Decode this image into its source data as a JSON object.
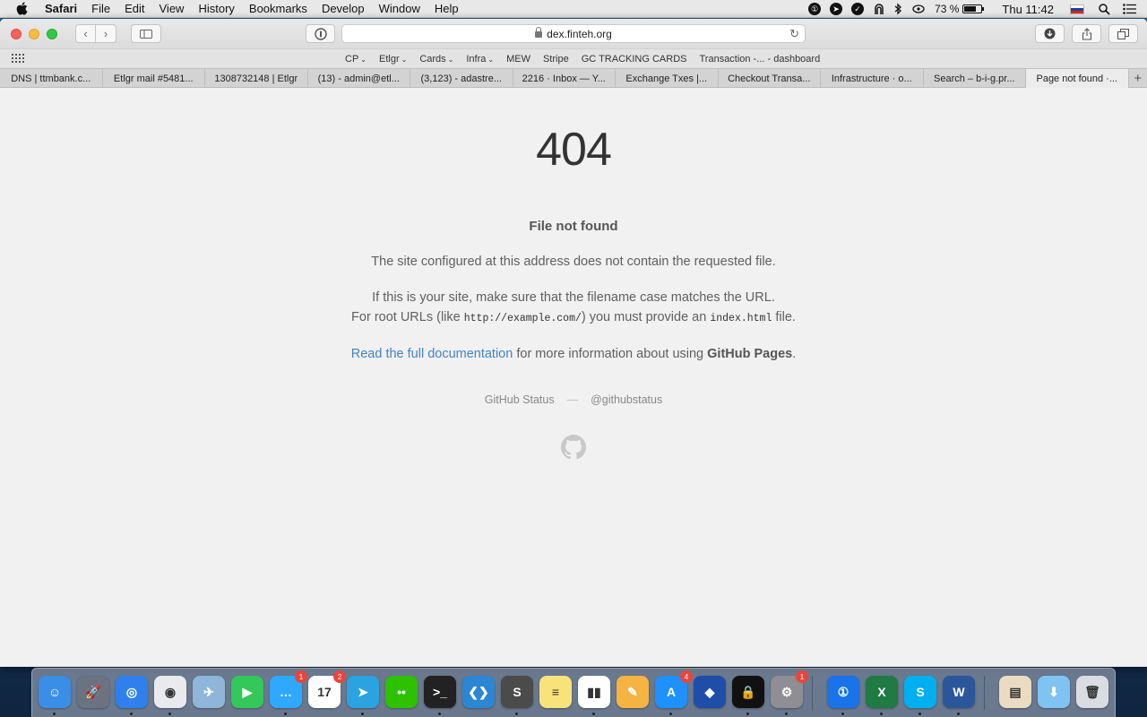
{
  "menubar": {
    "app_name": "Safari",
    "menus": [
      "File",
      "Edit",
      "View",
      "History",
      "Bookmarks",
      "Develop",
      "Window",
      "Help"
    ],
    "battery": "73 %",
    "battery_level": 0.73,
    "clock": "Thu 11:42"
  },
  "browser": {
    "url": "dex.finteh.org",
    "favorites": [
      {
        "label": "CP",
        "has_menu": true
      },
      {
        "label": "Etlgr",
        "has_menu": true
      },
      {
        "label": "Cards",
        "has_menu": true
      },
      {
        "label": "Infra",
        "has_menu": true
      },
      {
        "label": "MEW",
        "has_menu": false
      },
      {
        "label": "Stripe",
        "has_menu": false
      },
      {
        "label": "GC TRACKING CARDS",
        "has_menu": false
      },
      {
        "label": "Transaction -... - dashboard",
        "has_menu": false
      }
    ],
    "tabs": [
      {
        "label": "DNS | ttmbank.c...",
        "active": false
      },
      {
        "label": "Etlgr mail #5481...",
        "active": false
      },
      {
        "label": "1308732148 | Etlgr",
        "active": false
      },
      {
        "label": "(13) - admin@etl...",
        "active": false
      },
      {
        "label": "(3,123) - adastre...",
        "active": false
      },
      {
        "label": "2216 · Inbox — Y...",
        "active": false
      },
      {
        "label": "Exchange Txes |...",
        "active": false
      },
      {
        "label": "Checkout Transa...",
        "active": false
      },
      {
        "label": "Infrastructure · o...",
        "active": false
      },
      {
        "label": "Search – b-i-g.pr...",
        "active": false
      },
      {
        "label": "Page not found ·...",
        "active": true
      }
    ]
  },
  "page": {
    "code": "404",
    "title": "File not found",
    "para1": "The site configured at this address does not contain the requested file.",
    "para2_line1": "If this is your site, make sure that the filename case matches the URL.",
    "para2_line2_a": "For root URLs (like ",
    "para2_code1": "http://example.com/",
    "para2_line2_b": ") you must provide an ",
    "para2_code2": "index.html",
    "para2_line2_c": " file.",
    "docs_link": "Read the full documentation",
    "para3_mid": " for more information about using ",
    "para3_bold": "GitHub Pages",
    "para3_end": ".",
    "footer_status": "GitHub Status",
    "footer_sep": "—",
    "footer_handle": "@githubstatus"
  },
  "dock": {
    "apps": [
      {
        "name": "finder-icon",
        "color": "#3a8ee6",
        "glyph": "☺",
        "running": true,
        "badge": ""
      },
      {
        "name": "launchpad-icon",
        "color": "#6b7280",
        "glyph": "🚀",
        "running": false,
        "badge": ""
      },
      {
        "name": "safari-icon",
        "color": "#2f80ed",
        "glyph": "◎",
        "running": true,
        "badge": ""
      },
      {
        "name": "chrome-icon",
        "color": "#e8eaed",
        "glyph": "◉",
        "running": true,
        "badge": ""
      },
      {
        "name": "preview-icon",
        "color": "#8fb6d8",
        "glyph": "✈",
        "running": false,
        "badge": ""
      },
      {
        "name": "facetime-icon",
        "color": "#34c759",
        "glyph": "▶",
        "running": false,
        "badge": ""
      },
      {
        "name": "messages-icon",
        "color": "#2fa8ff",
        "glyph": "…",
        "running": true,
        "badge": "1"
      },
      {
        "name": "calendar-icon",
        "color": "#ffffff",
        "glyph": "17",
        "running": false,
        "badge": "2"
      },
      {
        "name": "telegram-icon",
        "color": "#2aa3e0",
        "glyph": "➤",
        "running": true,
        "badge": ""
      },
      {
        "name": "wechat-icon",
        "color": "#2dc100",
        "glyph": "••",
        "running": false,
        "badge": ""
      },
      {
        "name": "terminal-icon",
        "color": "#222222",
        "glyph": ">_",
        "running": true,
        "badge": ""
      },
      {
        "name": "vscode-icon",
        "color": "#2b86d4",
        "glyph": "❮❯",
        "running": false,
        "badge": ""
      },
      {
        "name": "sublime-text-icon",
        "color": "#4b4b4b",
        "glyph": "S",
        "running": true,
        "badge": ""
      },
      {
        "name": "notes-icon",
        "color": "#f7e37a",
        "glyph": "≡",
        "running": false,
        "badge": ""
      },
      {
        "name": "numbers-icon",
        "color": "#ffffff",
        "glyph": "▮▮",
        "running": true,
        "badge": ""
      },
      {
        "name": "pages-icon",
        "color": "#f5b342",
        "glyph": "✎",
        "running": false,
        "badge": ""
      },
      {
        "name": "app-store-icon",
        "color": "#1e90ff",
        "glyph": "A",
        "running": true,
        "badge": "4"
      },
      {
        "name": "trezor-icon",
        "color": "#1f4ea8",
        "glyph": "◆",
        "running": false,
        "badge": ""
      },
      {
        "name": "lock-app-icon",
        "color": "#111111",
        "glyph": "🔒",
        "running": true,
        "badge": ""
      },
      {
        "name": "system-preferences-icon",
        "color": "#8e8e93",
        "glyph": "⚙",
        "running": true,
        "badge": "1"
      },
      {
        "name": "1password-icon",
        "color": "#1a73e8",
        "glyph": "①",
        "running": true,
        "badge": ""
      },
      {
        "name": "excel-icon",
        "color": "#1f7a44",
        "glyph": "X",
        "running": true,
        "badge": ""
      },
      {
        "name": "skype-icon",
        "color": "#00aff0",
        "glyph": "S",
        "running": true,
        "badge": ""
      },
      {
        "name": "word-icon",
        "color": "#2b579a",
        "glyph": "W",
        "running": true,
        "badge": ""
      },
      {
        "name": "document-stack-icon",
        "color": "#e9dcc3",
        "glyph": "▤",
        "running": false,
        "badge": ""
      },
      {
        "name": "downloads-folder-icon",
        "color": "#7ec3f2",
        "glyph": "⬇",
        "running": false,
        "badge": ""
      },
      {
        "name": "trash-icon",
        "color": "#d9dde2",
        "glyph": "🗑",
        "running": false,
        "badge": ""
      }
    ]
  }
}
